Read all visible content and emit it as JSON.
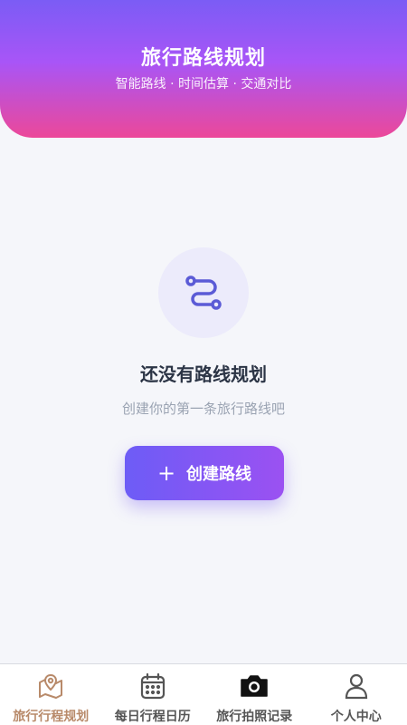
{
  "header": {
    "title": "旅行路线规划",
    "subtitle": "智能路线 · 时间估算 · 交通对比"
  },
  "empty_state": {
    "icon": "route-icon",
    "title": "还没有路线规划",
    "description": "创建你的第一条旅行路线吧"
  },
  "create_button": {
    "icon": "plus-icon",
    "label": "创建路线"
  },
  "tabbar": {
    "tabs": [
      {
        "label": "旅行行程规划",
        "icon": "map-pin-icon",
        "active": true
      },
      {
        "label": "每日行程日历",
        "icon": "calendar-icon",
        "active": false
      },
      {
        "label": "旅行拍照记录",
        "icon": "camera-icon",
        "active": false
      },
      {
        "label": "个人中心",
        "icon": "user-icon",
        "active": false
      }
    ]
  },
  "colors": {
    "header_gradient_top": "#7b5cf5",
    "header_gradient_bottom": "#ec4899",
    "button_gradient_start": "#6d5cf6",
    "button_gradient_end": "#9b51f2",
    "active_tab": "#b88a6a"
  }
}
